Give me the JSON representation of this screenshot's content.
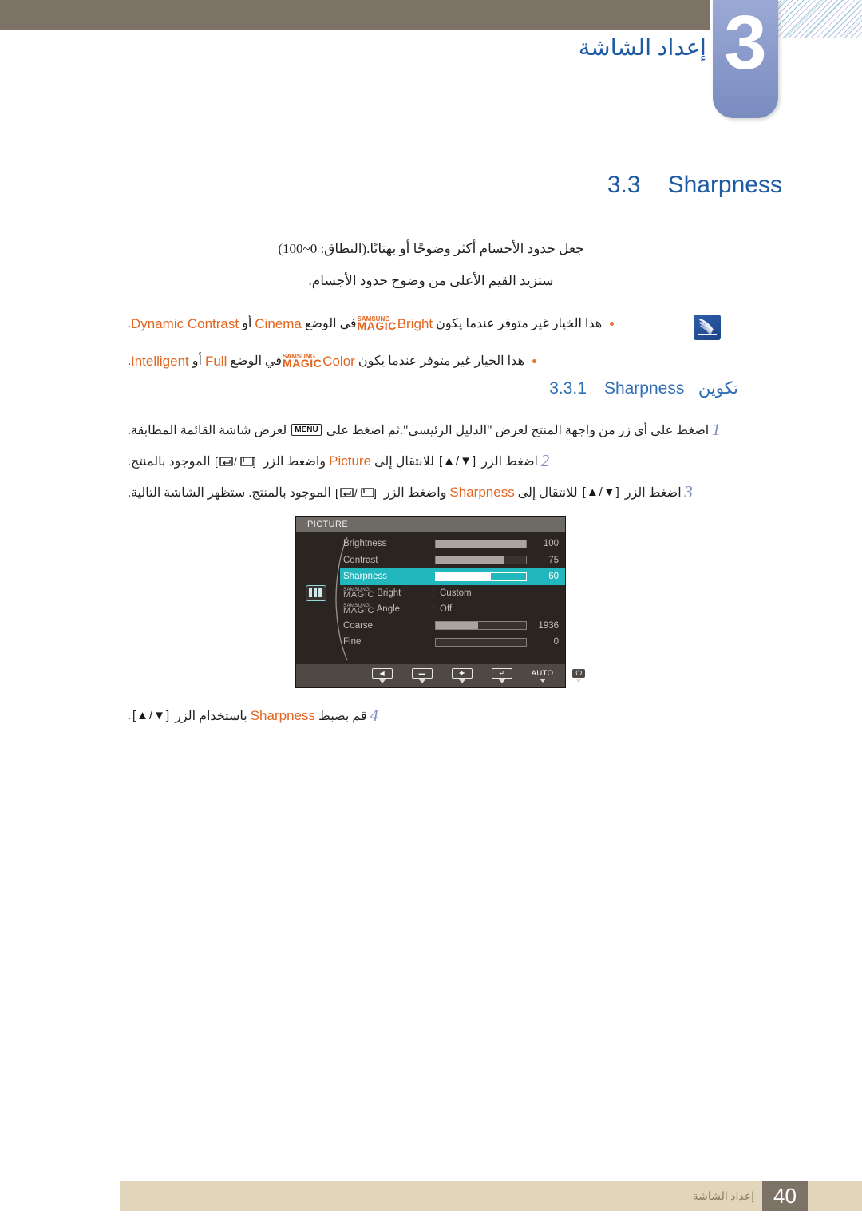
{
  "header": {
    "chapter_number": "3",
    "chapter_title": "إعداد الشاشة"
  },
  "section": {
    "number": "3.3",
    "title": "Sharpness",
    "desc_line1": "جعل حدود الأجسام أكثر وضوحًا أو بهتانًا.(النطاق: 0~100)",
    "desc_line2": "ستزيد القيم الأعلى من وضوح حدود الأجسام."
  },
  "note": {
    "icon": "note-pen-icon",
    "bullets": [
      {
        "pre": "هذا الخيار غير متوفر عندما يكون",
        "magic_small": "SAMSUNG",
        "magic_big": "MAGIC",
        "magic_suffix": "Bright",
        "mid": "في الوضع",
        "opt1": "Cinema",
        "conj": "أو",
        "opt2": "Dynamic Contrast",
        "end": "."
      },
      {
        "pre": "هذا الخيار غير متوفر عندما يكون",
        "magic_small": "SAMSUNG",
        "magic_big": "MAGIC",
        "magic_suffix": "Color",
        "mid": "في الوضع",
        "opt1": "Full",
        "conj": "أو",
        "opt2": "Intelligent",
        "end": "."
      }
    ]
  },
  "subsection": {
    "number": "3.3.1",
    "title_ar": "تكوين",
    "title_en": "Sharpness"
  },
  "steps": [
    {
      "num": "1",
      "p1": "اضغط على أي زر من واجهة المنتج لعرض \"الدليل الرئيسي\".ثم اضغط على",
      "key": "MENU",
      "p2": "لعرض شاشة القائمة المطابقة."
    },
    {
      "num": "2",
      "p1": "اضغط الزر",
      "arrows": "[▲/▼]",
      "p2": "للانتقال إلى",
      "target": "Picture",
      "p3": "واضغط الزر",
      "btns": "[ ↵ / ⎕ ]",
      "p4": "الموجود بالمنتج."
    },
    {
      "num": "3",
      "p1": "اضغط الزر",
      "arrows": "[▲/▼]",
      "p2": "للانتقال إلى",
      "target": "Sharpness",
      "p3": "واضغط الزر",
      "btns": "[ ↵ / ⎕ ]",
      "p4": "الموجود بالمنتج. ستظهر الشاشة التالية."
    },
    {
      "num": "4",
      "p1": "قم بضبط",
      "target": "Sharpness",
      "p2": "باستخدام الزر",
      "arrows": "[▲/▼]",
      "p3": "."
    }
  ],
  "osd": {
    "title": "PICTURE",
    "sidebar_icon": "picture-bars-icon",
    "rows": [
      {
        "label": "Brightness",
        "type": "bar",
        "fill": 100,
        "value": "100",
        "selected": false
      },
      {
        "label": "Contrast",
        "type": "bar",
        "fill": 75,
        "value": "75",
        "selected": false
      },
      {
        "label": "Sharpness",
        "type": "bar",
        "fill": 60,
        "value": "60",
        "selected": true
      },
      {
        "label_small": "SAMSUNG",
        "label_big": "MAGIC",
        "label_suffix": "Bright",
        "type": "text",
        "value": "Custom",
        "selected": false
      },
      {
        "label_small": "SAMSUNG",
        "label_big": "MAGIC",
        "label_suffix": "Angle",
        "type": "text",
        "value": "Off",
        "selected": false
      },
      {
        "label": "Coarse",
        "type": "bar",
        "fill": 45,
        "value": "1936",
        "selected": false
      },
      {
        "label": "Fine",
        "type": "bar",
        "fill": 0,
        "value": "0",
        "selected": false
      }
    ],
    "footer_buttons": [
      {
        "name": "left-arrow-button",
        "glyph": "◀"
      },
      {
        "name": "minus-button",
        "glyph": "▬"
      },
      {
        "name": "plus-button",
        "glyph": "✚"
      },
      {
        "name": "enter-button",
        "glyph": "↵"
      },
      {
        "name": "auto-button",
        "glyph": "AUTO"
      },
      {
        "name": "power-button",
        "glyph": "⏻"
      }
    ]
  },
  "footer": {
    "page_number": "40",
    "text": "إعداد الشاشة"
  },
  "colors": {
    "heading_blue": "#1f5ba3",
    "accent_orange": "#e2651f",
    "osd_highlight": "#22b7bd",
    "header_band": "#7d7266",
    "footer_band": "#e1d5bb"
  }
}
